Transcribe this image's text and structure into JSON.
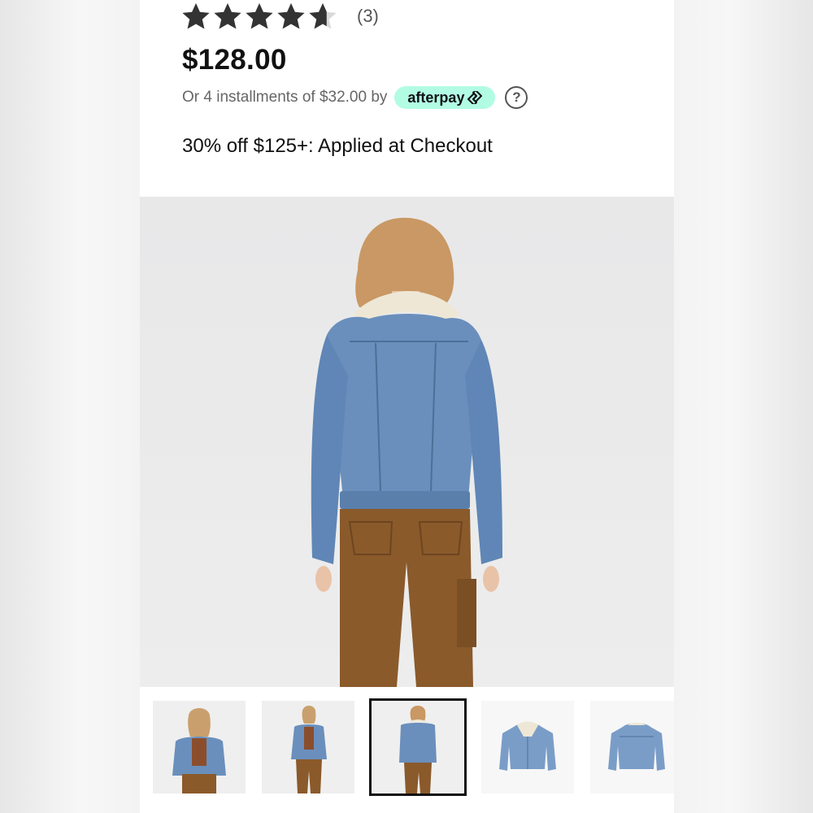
{
  "rating": {
    "value": 4.5,
    "max": 5,
    "count_label": "(3)"
  },
  "price": "$128.00",
  "installments": {
    "text": "Or 4 installments of $32.00 by",
    "provider": "afterpay",
    "badge_color": "#b2fce4"
  },
  "help_icon_glyph": "?",
  "promo": "30% off $125+: Applied at Checkout",
  "colors": {
    "star": "#333333",
    "denim": "#6a8fbc",
    "pants": "#8a5a2b",
    "sherpa": "#eee7d6",
    "hair": "#c99864"
  },
  "gallery": {
    "selected_index": 2,
    "thumbnails": [
      {
        "icon": "model-front-photo"
      },
      {
        "icon": "model-full-front-photo"
      },
      {
        "icon": "model-back-photo"
      },
      {
        "icon": "jacket-front-flat-photo"
      },
      {
        "icon": "jacket-back-flat-photo"
      }
    ]
  }
}
